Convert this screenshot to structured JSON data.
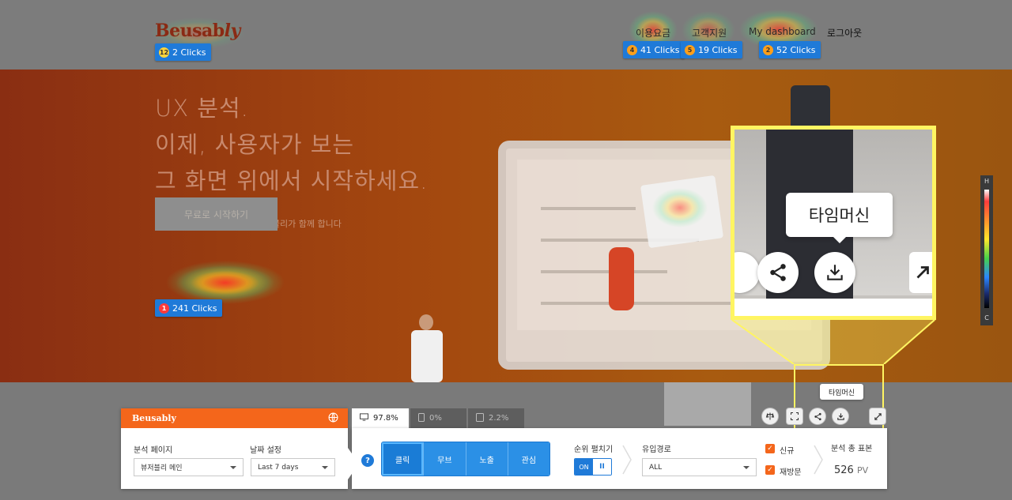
{
  "site": {
    "logo": "Beusably",
    "logo_main": "Beusab",
    "logo_tail": "ly",
    "nav": [
      "이용요금",
      "고객지원",
      "My dashboard",
      "로그아웃"
    ],
    "hero_lines": [
      "UX 분석.",
      "이제, 사용자가 보는",
      "그 화면 위에서 시작하세요."
    ],
    "hero_sub": "가장 쉬운 UX 데이터 분석, 뷰저블리가 함께 합니다",
    "cta": "무료로 시작하기"
  },
  "click_badges": [
    {
      "rank": "12",
      "label": "2 Clicks",
      "rank_color": "#ffd43b"
    },
    {
      "rank": "4",
      "label": "41 Clicks",
      "rank_color": "#ff9f1a"
    },
    {
      "rank": "5",
      "label": "19 Clicks",
      "rank_color": "#ff9f1a"
    },
    {
      "rank": "2",
      "label": "52 Clicks",
      "rank_color": "#ff9f1a"
    },
    {
      "rank": "1",
      "label": "241 Clicks",
      "rank_color": "#ff3b3b"
    }
  ],
  "zoom": {
    "tooltip": "타임머신"
  },
  "small_tooltip": "타임머신",
  "scale": {
    "top": "H",
    "bottom": "C"
  },
  "panel": {
    "logo": "Beusably",
    "page_label": "분석 페이지",
    "page_value": "뷰저블리 메인",
    "date_label": "날짜 설정",
    "date_value": "Last 7 days",
    "device_tabs": [
      {
        "label": "97.8%",
        "icon": "desktop-icon",
        "active": true
      },
      {
        "label": "0%",
        "icon": "mobile-icon",
        "active": false
      },
      {
        "label": "2.2%",
        "icon": "tablet-icon",
        "active": false
      }
    ],
    "help": "?",
    "modes": [
      "클릭",
      "무브",
      "노출",
      "관심"
    ],
    "rank_label": "순위 펼치기",
    "toggle_on": "ON",
    "toggle_pause": "II",
    "source_label": "유입경로",
    "source_value": "ALL",
    "new_label": "신규",
    "return_label": "재방문",
    "sample_label": "분석 총 표본",
    "sample_value": "526",
    "sample_unit": "PV"
  },
  "colors": {
    "brand": "#f4661b",
    "accent": "#1f7ad8",
    "highlight": "#fff562"
  }
}
